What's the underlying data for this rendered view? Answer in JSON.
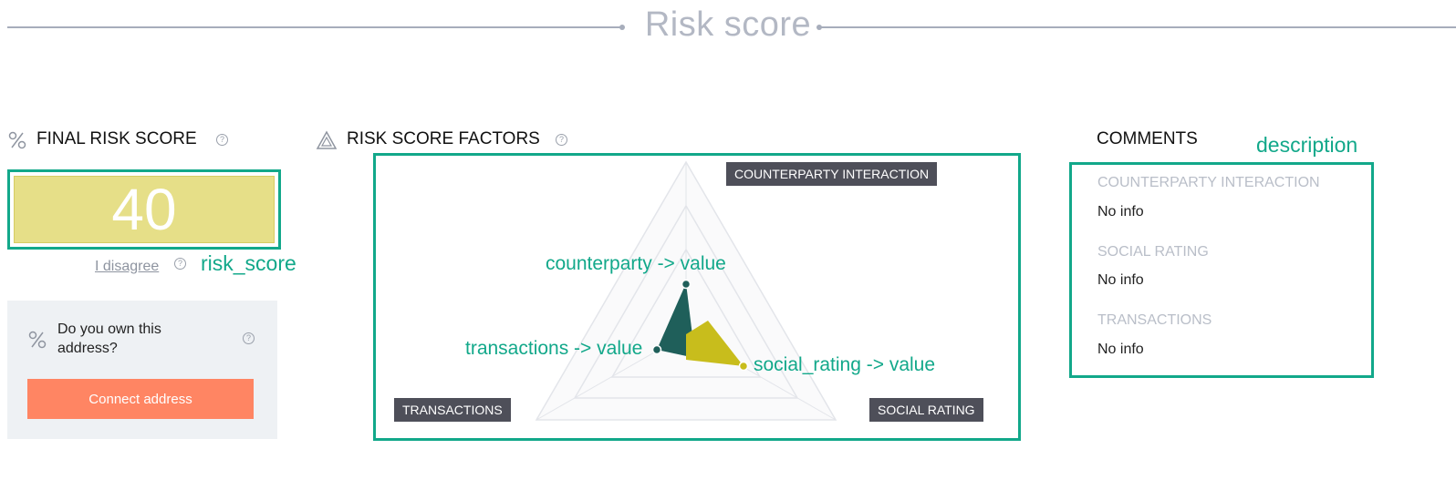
{
  "header": {
    "title": "Risk score"
  },
  "final_risk_score": {
    "title": "FINAL RISK SCORE",
    "icon": "percent-icon",
    "value": "40",
    "disagree_link": "I disagree",
    "annotation": "risk_score"
  },
  "own_address": {
    "question": "Do you own this address?",
    "button_label": "Connect address"
  },
  "risk_factors": {
    "title": "RISK SCORE FACTORS",
    "icon": "triangle-icon",
    "axes": {
      "counterparty": "COUNTERPARTY INTERACTION",
      "transactions": "TRANSACTIONS",
      "social": "SOCIAL RATING"
    },
    "value_labels": {
      "counterparty": "counterparty -> value",
      "transactions": "transactions -> value",
      "social": "social_rating -> value"
    },
    "colors": {
      "dark": "#1f5f5a",
      "yellow": "#c8bd1c",
      "grid": "#e3e5ea"
    }
  },
  "comments": {
    "title": "COMMENTS",
    "annotation": "description",
    "items": [
      {
        "label": "COUNTERPARTY INTERACTION",
        "value": "No info"
      },
      {
        "label": "SOCIAL RATING",
        "value": "No info"
      },
      {
        "label": "TRANSACTIONS",
        "value": "No info"
      }
    ]
  },
  "help_glyph": "?"
}
